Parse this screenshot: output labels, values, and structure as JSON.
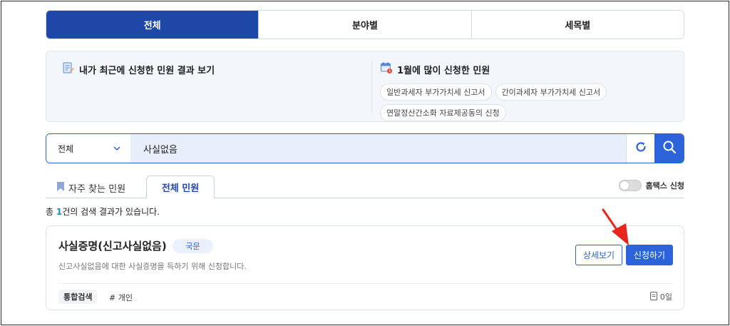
{
  "top_tabs": [
    {
      "label": "전체",
      "active": true
    },
    {
      "label": "분야별",
      "active": false
    },
    {
      "label": "세목별",
      "active": false
    }
  ],
  "info": {
    "recent_title": "내가 최근에 신청한 민원 결과 보기",
    "popular_title": "1월에 많이 신청한 민원",
    "popular_items": [
      "일반과세자 부가가치세 신고서",
      "간이과세자 부가가치세 신고서",
      "연말정산간소화 자료제공동의 신청"
    ]
  },
  "search": {
    "category": "전체",
    "query": "사실없음"
  },
  "sub_tabs": {
    "favorite_label": "자주 찾는 민원",
    "all_label": "전체 민원",
    "hometax_label": "홈택스 신청"
  },
  "result_count": {
    "prefix": "총 ",
    "count": "1",
    "suffix": "건의 검색 결과가 있습니다."
  },
  "result": {
    "title": "사실증명(신고사실없음)",
    "badge": "국문",
    "description": "신고사실없음에 대한 사실증명을 득하기 위해 신청합니다.",
    "tag": "통합검색",
    "hashtag": "# 개인",
    "days": "0일",
    "detail_label": "상세보기",
    "apply_label": "신청하기"
  },
  "colors": {
    "primary": "#1f47a8",
    "accent": "#2c63d8",
    "annotation": "#e8261c"
  }
}
